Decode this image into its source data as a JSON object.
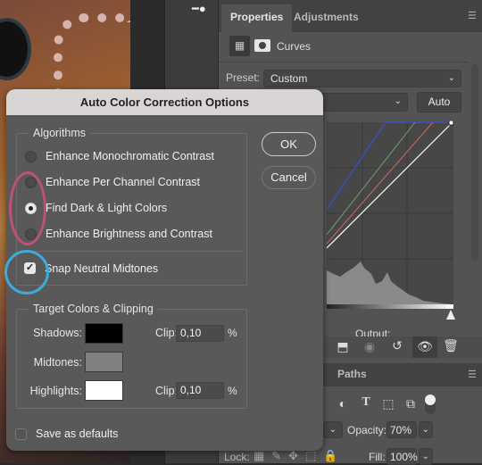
{
  "dialog": {
    "title": "Auto Color Correction Options",
    "algorithms_label": "Algorithms",
    "algorithms": [
      {
        "label": "Enhance Monochromatic Contrast",
        "selected": false
      },
      {
        "label": "Enhance Per Channel Contrast",
        "selected": false
      },
      {
        "label": "Find Dark & Light Colors",
        "selected": true
      },
      {
        "label": "Enhance Brightness and Contrast",
        "selected": false
      }
    ],
    "snap_neutral_midtones": {
      "label": "Snap Neutral Midtones",
      "checked": true
    },
    "ok_label": "OK",
    "cancel_label": "Cancel",
    "target_label": "Target Colors & Clipping",
    "shadows": {
      "label": "Shadows:",
      "color": "#000000",
      "clip_label": "Clip:",
      "clip": "0,10",
      "unit": "%"
    },
    "midtones": {
      "label": "Midtones:",
      "color": "#808080"
    },
    "highlights": {
      "label": "Highlights:",
      "color": "#ffffff",
      "clip_label": "Clip:",
      "clip": "0,10",
      "unit": "%"
    },
    "save_defaults": {
      "label": "Save as defaults",
      "checked": false
    },
    "annotation_colors": {
      "radio_highlight": "#c0507a",
      "checkbox_highlight": "#3fa9dc"
    }
  },
  "properties": {
    "tabs": [
      {
        "label": "Properties",
        "active": true
      },
      {
        "label": "Adjustments",
        "active": false
      }
    ],
    "adjustment_name": "Curves",
    "preset_label": "Preset:",
    "preset_value": "Custom",
    "auto_label": "Auto",
    "output_label": "Output:",
    "curve_colors": {
      "rgb": "#ffffff",
      "red": "#c96a5f",
      "green": "#6fa46b",
      "blue": "#3e4ea3"
    },
    "footer_icons": [
      "clip-to-layer-icon",
      "view-previous-icon",
      "reset-icon",
      "visibility-icon",
      "trash-icon"
    ]
  },
  "layers": {
    "tab_label": "Paths",
    "opacity_label": "Opacity:",
    "opacity_value": "70%",
    "lock_label": "Lock:",
    "fill_label": "Fill:",
    "fill_value": "100%"
  }
}
